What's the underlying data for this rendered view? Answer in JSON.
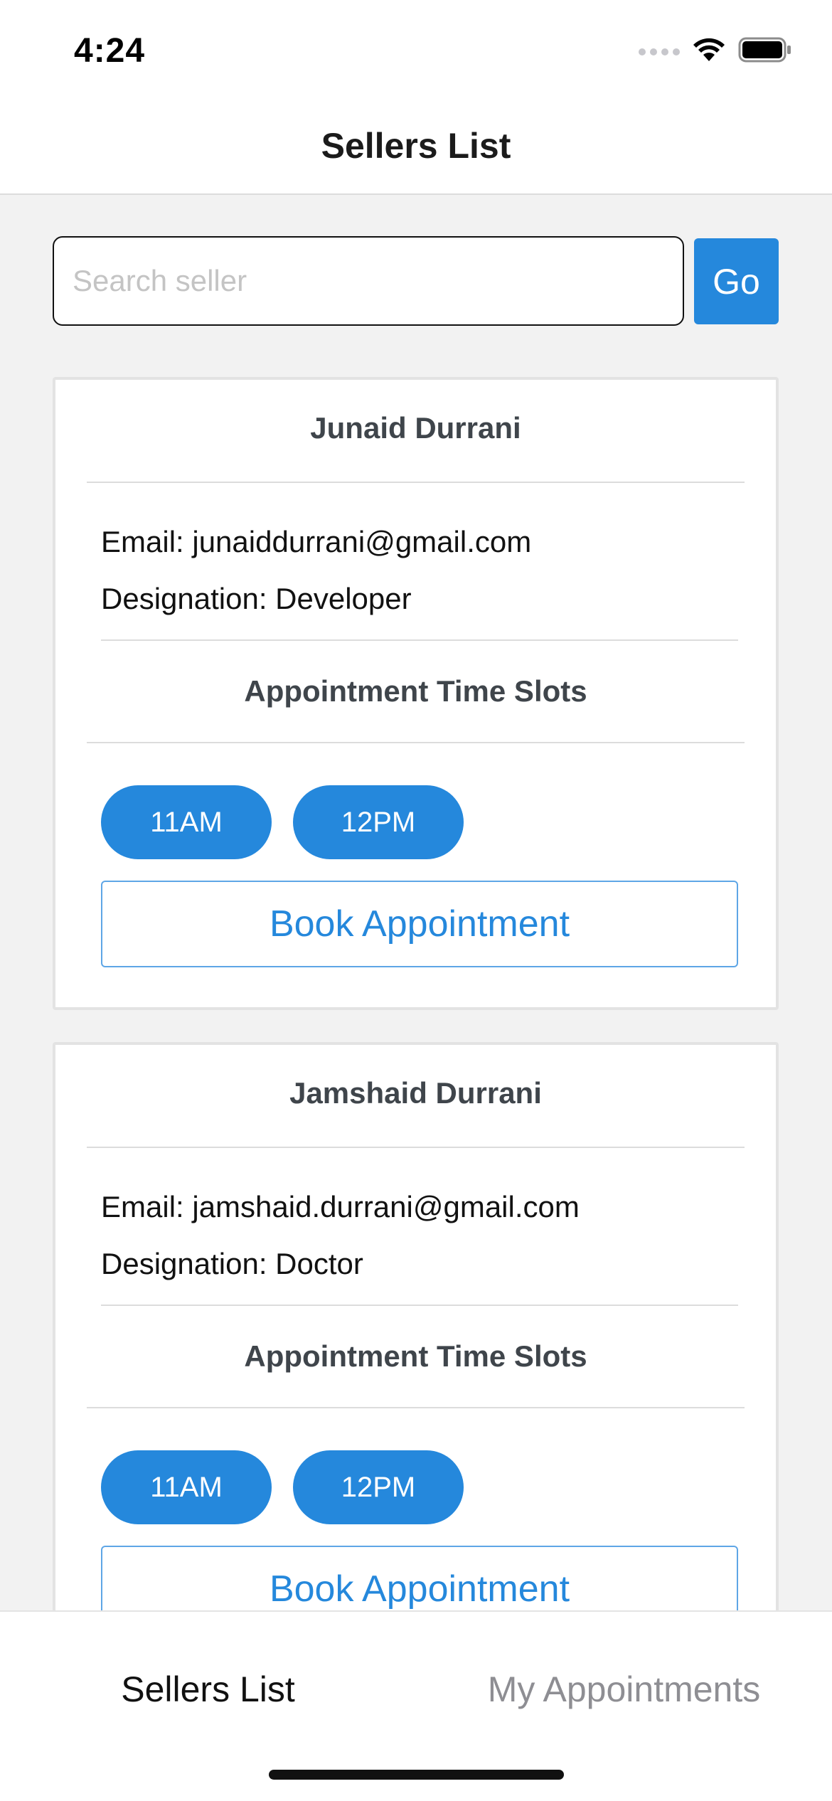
{
  "status_bar": {
    "time": "4:24"
  },
  "header": {
    "title": "Sellers List"
  },
  "search": {
    "placeholder": "Search seller",
    "value": "",
    "go_label": "Go"
  },
  "sellers": [
    {
      "name": "Junaid Durrani",
      "email_line": "Email: junaiddurrani@gmail.com",
      "designation_line": "Designation: Developer",
      "slots_title": "Appointment Time Slots",
      "slots": [
        "11AM",
        "12PM"
      ],
      "book_label": "Book Appointment"
    },
    {
      "name": "Jamshaid Durrani",
      "email_line": "Email: jamshaid.durrani@gmail.com",
      "designation_line": "Designation: Doctor",
      "slots_title": "Appointment Time Slots",
      "slots": [
        "11AM",
        "12PM"
      ],
      "book_label": "Book Appointment"
    }
  ],
  "tab_bar": {
    "tabs": [
      {
        "label": "Sellers List",
        "active": true
      },
      {
        "label": "My Appointments",
        "active": false
      }
    ]
  },
  "colors": {
    "accent": "#2588dc",
    "active_tab": "#111111",
    "inactive_tab": "#8e8e93"
  }
}
